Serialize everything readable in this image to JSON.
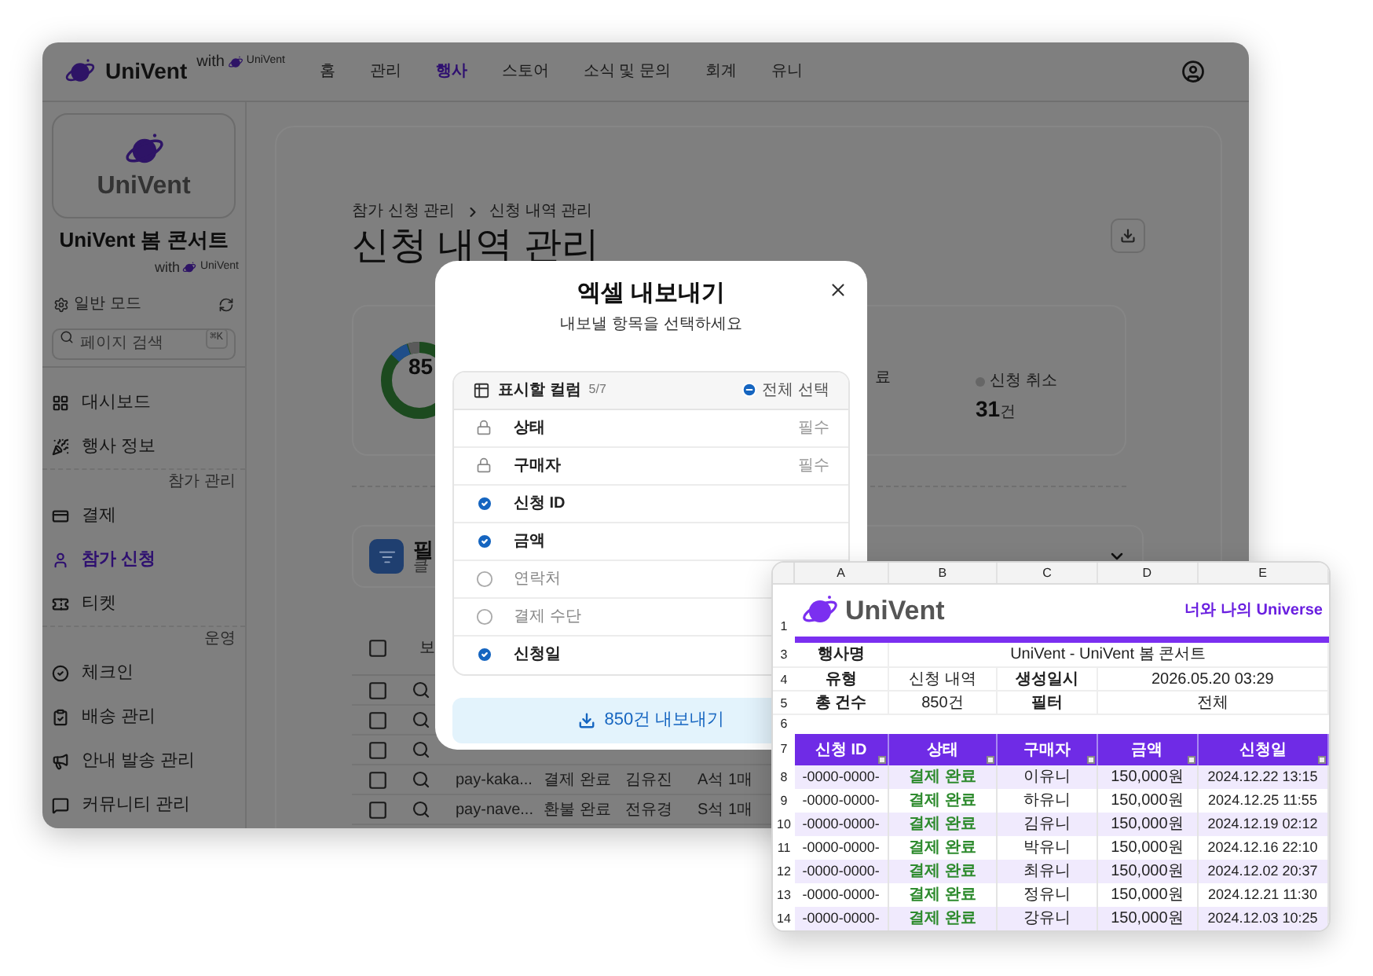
{
  "nav": {
    "brand": "UniVent",
    "with": "with",
    "partner": "UniVent",
    "items": [
      {
        "label": "홈",
        "selected": false
      },
      {
        "label": "관리",
        "selected": false
      },
      {
        "label": "행사",
        "selected": true
      },
      {
        "label": "스토어",
        "selected": false
      },
      {
        "label": "소식 및 문의",
        "selected": false
      },
      {
        "label": "회계",
        "selected": false
      },
      {
        "label": "유니",
        "selected": false
      }
    ]
  },
  "sidebar": {
    "logo_text": "UniVent",
    "event_title": "UniVent 봄 콘서트",
    "with": "with",
    "partner": "UniVent",
    "mode": "일반 모드",
    "search": {
      "placeholder": "페이지 검색",
      "shortcut": "⌘K"
    },
    "items": [
      {
        "kind": "item",
        "label": "대시보드",
        "selected": false
      },
      {
        "kind": "item",
        "label": "행사 정보",
        "selected": false
      },
      {
        "kind": "section",
        "label": "참가 관리"
      },
      {
        "kind": "item",
        "label": "결제",
        "selected": false
      },
      {
        "kind": "item",
        "label": "참가 신청",
        "selected": true
      },
      {
        "kind": "item",
        "label": "티켓",
        "selected": false
      },
      {
        "kind": "section",
        "label": "운영"
      },
      {
        "kind": "item",
        "label": "체크인",
        "selected": false
      },
      {
        "kind": "item",
        "label": "배송 관리",
        "selected": false
      },
      {
        "kind": "item",
        "label": "안내 발송 관리",
        "selected": false
      },
      {
        "kind": "item",
        "label": "커뮤니티 관리",
        "selected": false
      }
    ]
  },
  "main": {
    "breadcrumb": [
      "참가 신청 관리",
      "신청 내역 관리"
    ],
    "title": "신청 내역 관리",
    "stats": {
      "total": "85",
      "completed_label": "료",
      "cancel_label": "신청 취소",
      "cancel_value": "31",
      "cancel_unit": "건"
    },
    "filter": {
      "title": "필",
      "subtitle": "클"
    },
    "table": {
      "header": "보",
      "header_checked": false,
      "rows": [
        {
          "checked": false
        },
        {
          "checked": false
        },
        {
          "checked": false
        },
        {
          "checked": false,
          "cells": [
            "pay-kaka...",
            "결제 완료",
            "김유진",
            "A석 1매"
          ]
        },
        {
          "checked": false,
          "cells": [
            "pay-nave...",
            "환불 완료",
            "전유경",
            "S석 1매"
          ]
        }
      ]
    }
  },
  "modal": {
    "title": "엑셀 내보내기",
    "subtitle": "내보낼 항목을 선택하세요",
    "columns_label": "표시할 컬럼",
    "count": "5/7",
    "select_all": "전체 선택",
    "items": [
      {
        "kind": "locked",
        "label": "상태",
        "note": "필수"
      },
      {
        "kind": "locked",
        "label": "구매자",
        "note": "필수"
      },
      {
        "kind": "check",
        "label": "신청 ID",
        "checked": true
      },
      {
        "kind": "check",
        "label": "금액",
        "checked": true
      },
      {
        "kind": "check",
        "label": "연락처",
        "checked": false
      },
      {
        "kind": "check",
        "label": "결제 수단",
        "checked": false
      },
      {
        "kind": "check",
        "label": "신청일",
        "checked": true
      }
    ],
    "export_button": "850건 내보내기"
  },
  "spreadsheet": {
    "columns": [
      "A",
      "B",
      "C",
      "D",
      "E"
    ],
    "logo_row": "1",
    "brand": "UniVent",
    "tagline": "너와 나의 Universe",
    "info_rows": [
      {
        "number": "3",
        "cells": [
          "행사명",
          "UniVent - UniVent 봄 콘서트"
        ]
      },
      {
        "number": "4",
        "cells": [
          "유형",
          "신청 내역",
          "생성일시",
          "2026.05.20 03:29"
        ]
      },
      {
        "number": "5",
        "cells": [
          "총 건수",
          "850건",
          "필터",
          "전체"
        ]
      }
    ],
    "blank_row": "6",
    "header_row": {
      "number": "7",
      "cells": [
        "신청 ID",
        "상태",
        "구매자",
        "금액",
        "신청일"
      ]
    },
    "rows": [
      {
        "number": "8",
        "cells": [
          "-0000-0000-",
          "결제 완료",
          "이유니",
          "150,000원",
          "2024.12.22 13:15"
        ]
      },
      {
        "number": "9",
        "cells": [
          "-0000-0000-",
          "결제 완료",
          "하유니",
          "150,000원",
          "2024.12.25 11:55"
        ]
      },
      {
        "number": "10",
        "cells": [
          "-0000-0000-",
          "결제 완료",
          "김유니",
          "150,000원",
          "2024.12.19 02:12"
        ]
      },
      {
        "number": "11",
        "cells": [
          "-0000-0000-",
          "결제 완료",
          "박유니",
          "150,000원",
          "2024.12.16 22:10"
        ]
      },
      {
        "number": "12",
        "cells": [
          "-0000-0000-",
          "결제 완료",
          "최유니",
          "150,000원",
          "2024.12.02 20:37"
        ]
      },
      {
        "number": "13",
        "cells": [
          "-0000-0000-",
          "결제 완료",
          "정유니",
          "150,000원",
          "2024.12.21 11:30"
        ]
      },
      {
        "number": "14",
        "cells": [
          "-0000-0000-",
          "결제 완료",
          "강유니",
          "150,000원",
          "2024.12.03 10:25"
        ]
      }
    ]
  }
}
